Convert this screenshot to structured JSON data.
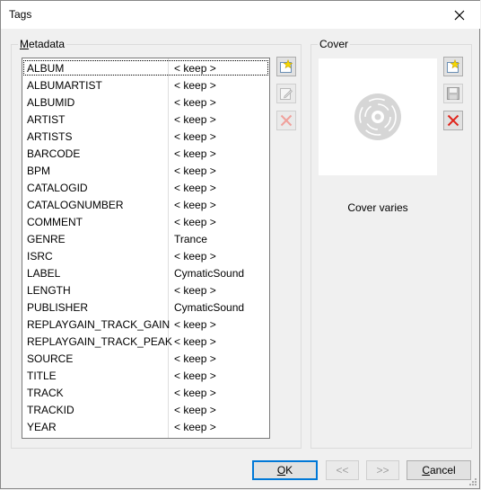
{
  "window": {
    "title": "Tags"
  },
  "metadata": {
    "label": "Metadata",
    "label_mnemonic": "M",
    "label_rest": "etadata",
    "rows": [
      {
        "key": "ALBUM",
        "value": "< keep >"
      },
      {
        "key": "ALBUMARTIST",
        "value": "< keep >"
      },
      {
        "key": "ALBUMID",
        "value": "< keep >"
      },
      {
        "key": "ARTIST",
        "value": "< keep >"
      },
      {
        "key": "ARTISTS",
        "value": "< keep >"
      },
      {
        "key": "BARCODE",
        "value": "< keep >"
      },
      {
        "key": "BPM",
        "value": "< keep >"
      },
      {
        "key": "CATALOGID",
        "value": "< keep >"
      },
      {
        "key": "CATALOGNUMBER",
        "value": "< keep >"
      },
      {
        "key": "COMMENT",
        "value": "< keep >"
      },
      {
        "key": "GENRE",
        "value": "Trance"
      },
      {
        "key": "ISRC",
        "value": "< keep >"
      },
      {
        "key": "LABEL",
        "value": "CymaticSound"
      },
      {
        "key": "LENGTH",
        "value": "< keep >"
      },
      {
        "key": "PUBLISHER",
        "value": "CymaticSound"
      },
      {
        "key": "REPLAYGAIN_TRACK_GAIN",
        "value": "< keep >"
      },
      {
        "key": "REPLAYGAIN_TRACK_PEAK",
        "value": "< keep >"
      },
      {
        "key": "SOURCE",
        "value": "< keep >"
      },
      {
        "key": "TITLE",
        "value": "< keep >"
      },
      {
        "key": "TRACK",
        "value": "< keep >"
      },
      {
        "key": "TRACKID",
        "value": "< keep >"
      },
      {
        "key": "YEAR",
        "value": "< keep >"
      }
    ]
  },
  "cover": {
    "label": "Cover",
    "caption": "Cover varies"
  },
  "buttons": {
    "ok_mnemonic": "O",
    "ok_rest": "K",
    "prev": "<<",
    "next": ">>",
    "cancel_mnemonic": "C",
    "cancel_rest": "ancel"
  },
  "icons": {
    "add": "star-add-icon",
    "edit": "edit-icon",
    "delete": "red-x-icon",
    "save": "floppy-disk-icon",
    "placeholder": "disc-icon"
  },
  "colors": {
    "focus": "#0078d7",
    "delete": "#e0241b",
    "star": "#f5d800"
  }
}
